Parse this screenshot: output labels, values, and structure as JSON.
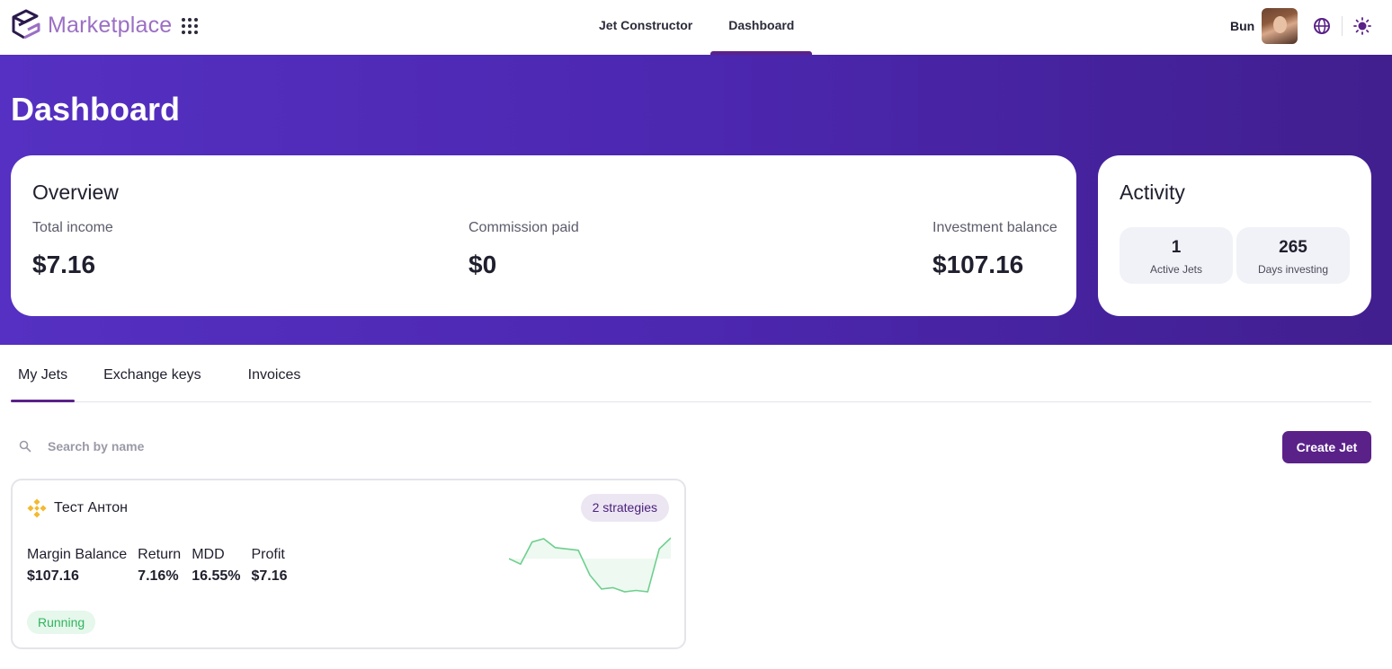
{
  "app": {
    "brand": "Marketplace",
    "apps_icon": "grid-dots-icon"
  },
  "nav": {
    "items": [
      {
        "label": "Jet Constructor",
        "active": false
      },
      {
        "label": "Dashboard",
        "active": true
      }
    ]
  },
  "user": {
    "name": "Bun",
    "icons": [
      "globe-icon",
      "sun-icon"
    ]
  },
  "hero": {
    "title": "Dashboard"
  },
  "overview": {
    "title": "Overview",
    "stats": [
      {
        "label": "Total income",
        "value": "$7.16"
      },
      {
        "label": "Commission paid",
        "value": "$0"
      },
      {
        "label": "Investment balance",
        "value": "$107.16"
      }
    ]
  },
  "activity": {
    "title": "Activity",
    "items": [
      {
        "value": "1",
        "label": "Active Jets"
      },
      {
        "value": "265",
        "label": "Days investing"
      }
    ]
  },
  "tabs": [
    {
      "label": "My Jets",
      "active": true
    },
    {
      "label": "Exchange keys",
      "active": false
    },
    {
      "label": "Invoices",
      "active": false
    }
  ],
  "search": {
    "placeholder": "Search by name",
    "value": ""
  },
  "create_button": "Create Jet",
  "jets": [
    {
      "name": "Тест Антон",
      "exchange_icon": "binance-icon",
      "strategies": "2 strategies",
      "metrics": [
        {
          "label": "Margin Balance",
          "value": "$107.16"
        },
        {
          "label": "Return",
          "value": "7.16%"
        },
        {
          "label": "MDD",
          "value": "16.55%"
        },
        {
          "label": "Profit",
          "value": "$7.16"
        }
      ],
      "status": "Running",
      "sparkline": [
        0.0,
        -0.2,
        0.6,
        0.72,
        0.4,
        0.35,
        0.3,
        -0.6,
        -1.1,
        -1.05,
        -1.2,
        -1.15,
        -1.2,
        0.35,
        0.75
      ],
      "sparkline_color": "#6fcf8e"
    }
  ],
  "colors": {
    "accent": "#5a2289",
    "hero_gradient_start": "#5530c2",
    "hero_gradient_end": "#411f8e",
    "brand_text": "#9b6fc4",
    "status_running": "#2fb55c"
  }
}
